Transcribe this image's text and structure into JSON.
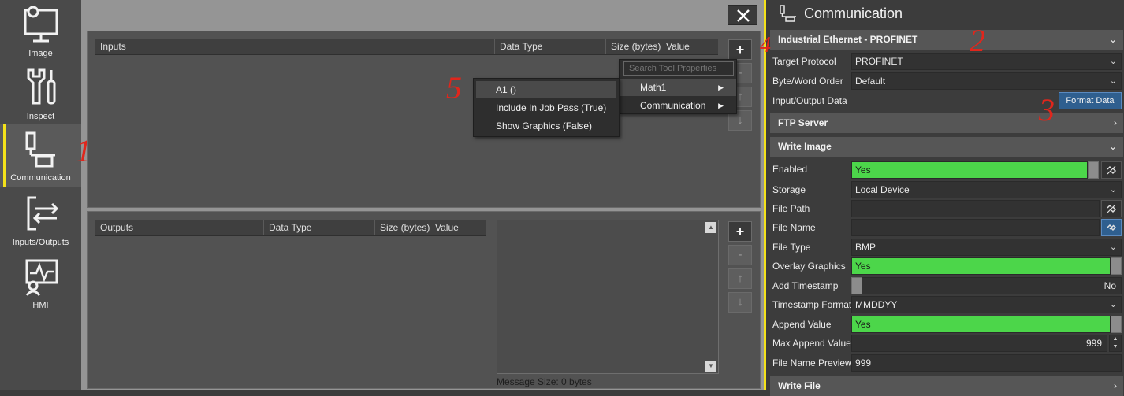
{
  "nav": {
    "items": [
      {
        "label": "Image",
        "icon": "monitor-gear-icon"
      },
      {
        "label": "Inspect",
        "icon": "tools-icon"
      },
      {
        "label": "Communication",
        "icon": "network-icon"
      },
      {
        "label": "Inputs/Outputs",
        "icon": "io-arrows-icon"
      },
      {
        "label": "HMI",
        "icon": "hmi-icon"
      }
    ]
  },
  "inputs_table": {
    "headers": [
      "Inputs",
      "Data Type",
      "Size (bytes)",
      "Value"
    ]
  },
  "outputs_table": {
    "headers": [
      "Outputs",
      "Data Type",
      "Size (bytes)",
      "Value"
    ],
    "message_size": "Message Size: 0 bytes"
  },
  "side_buttons": {
    "add": "+",
    "remove": "-",
    "up": "↑",
    "down": "↓"
  },
  "context_menu": {
    "search_placeholder": "Search Tool Properties",
    "items": [
      "Math1",
      "Communication"
    ],
    "submenu": [
      "A1 ()",
      "Include In Job Pass (True)",
      "Show Graphics (False)"
    ]
  },
  "annotations": [
    "1",
    "2",
    "3",
    "4",
    "5"
  ],
  "right_panel": {
    "title": "Communication",
    "industrial": {
      "section": "Industrial Ethernet - PROFINET",
      "target_protocol_label": "Target Protocol",
      "target_protocol": "PROFINET",
      "byte_order_label": "Byte/Word Order",
      "byte_order": "Default",
      "io_label": "Input/Output Data",
      "format_button": "Format Data"
    },
    "ftp_section": "FTP Server",
    "write_image": {
      "section": "Write Image",
      "enabled_label": "Enabled",
      "enabled": "Yes",
      "storage_label": "Storage",
      "storage": "Local Device",
      "file_path_label": "File Path",
      "file_path": "",
      "file_name_label": "File Name",
      "file_name": "",
      "file_type_label": "File Type",
      "file_type": "BMP",
      "overlay_label": "Overlay Graphics",
      "overlay": "Yes",
      "timestamp_label": "Add Timestamp",
      "timestamp": "No",
      "ts_format_label": "Timestamp Format",
      "ts_format": "MMDDYY",
      "append_label": "Append Value",
      "append": "Yes",
      "max_append_label": "Max Append Value",
      "max_append": "999",
      "preview_label": "File Name Preview",
      "preview": "999"
    },
    "write_file_section": "Write File"
  },
  "colors": {
    "accent": "#f4e21a",
    "toggle_on": "#4cd64a",
    "annotation": "#e0261c",
    "format_button": "#2f5f8f"
  }
}
